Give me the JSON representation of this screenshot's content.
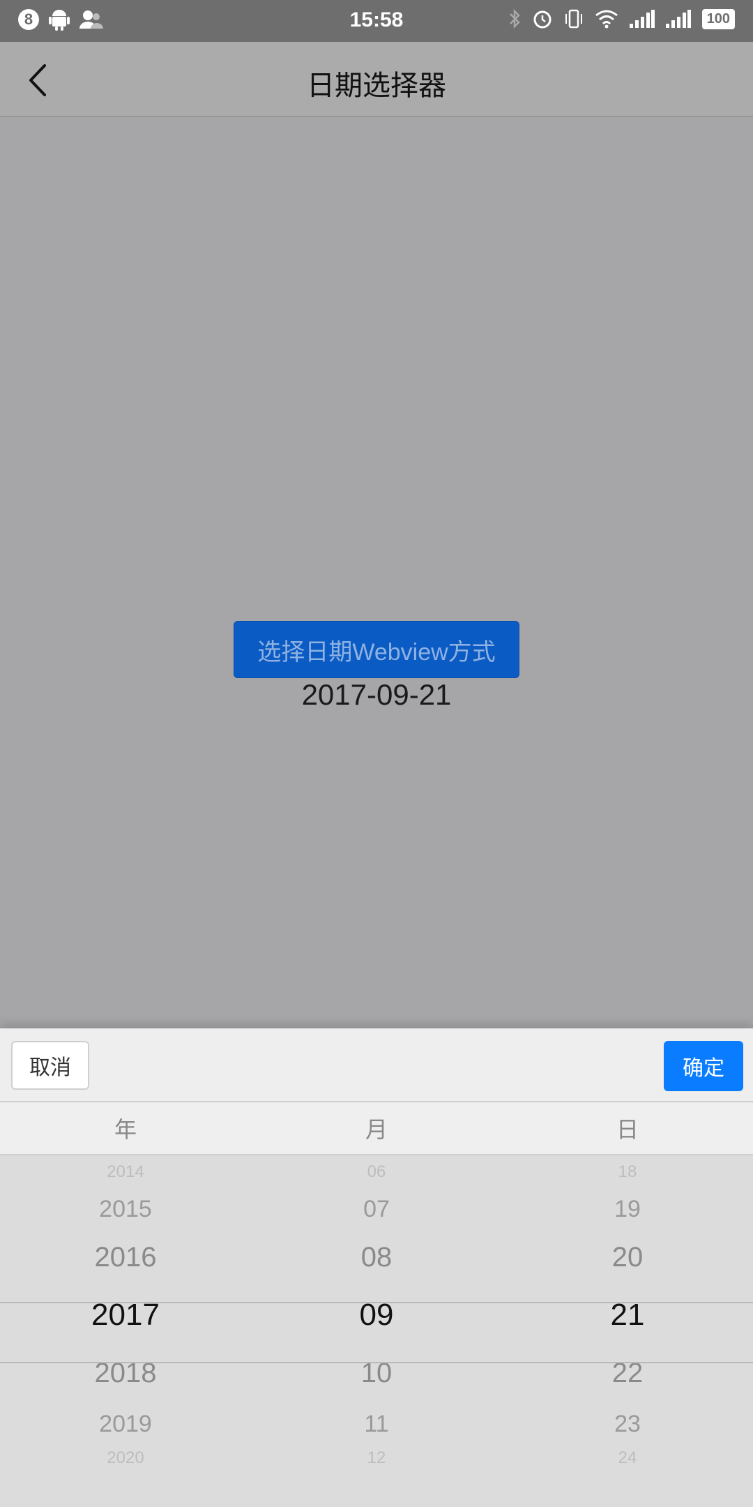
{
  "status_bar": {
    "notification_count": "8",
    "time": "15:58",
    "battery": "100"
  },
  "nav": {
    "title": "日期选择器"
  },
  "main": {
    "button_label": "选择日期Webview方式",
    "selected_date": "2017-09-21"
  },
  "picker": {
    "cancel_label": "取消",
    "confirm_label": "确定",
    "headers": {
      "year": "年",
      "month": "月",
      "day": "日"
    },
    "year": [
      "2014",
      "2015",
      "2016",
      "2017",
      "2018",
      "2019",
      "2020"
    ],
    "month": [
      "06",
      "07",
      "08",
      "09",
      "10",
      "11",
      "12"
    ],
    "day": [
      "18",
      "19",
      "20",
      "21",
      "22",
      "23",
      "24"
    ]
  },
  "colors": {
    "overlay_bg": "#a6a6a9",
    "primary_button": "#0b5bc4",
    "confirm_button": "#0a7cff"
  }
}
